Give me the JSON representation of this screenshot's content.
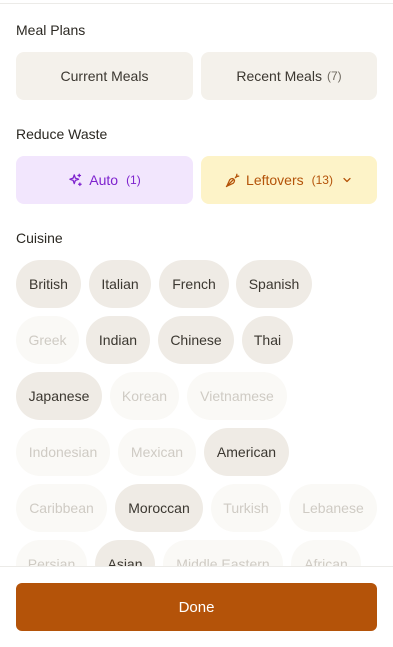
{
  "meal_plans": {
    "title": "Meal Plans",
    "current_label": "Current Meals",
    "recent_label": "Recent Meals",
    "recent_count": "(7)"
  },
  "reduce_waste": {
    "title": "Reduce Waste",
    "auto_label": "Auto",
    "auto_count": "(1)",
    "auto_icon": "sparkles-icon",
    "leftovers_label": "Leftovers",
    "leftovers_count": "(13)",
    "leftovers_icon": "carrot-icon",
    "accent_auto": "#7e22ce",
    "accent_leftovers": "#b45309"
  },
  "cuisine": {
    "title": "Cuisine",
    "chips": [
      {
        "label": "British",
        "active": true
      },
      {
        "label": "Italian",
        "active": true
      },
      {
        "label": "French",
        "active": true
      },
      {
        "label": "Spanish",
        "active": true
      },
      {
        "label": "Greek",
        "active": false
      },
      {
        "label": "Indian",
        "active": true
      },
      {
        "label": "Chinese",
        "active": true
      },
      {
        "label": "Thai",
        "active": true
      },
      {
        "label": "Japanese",
        "active": true
      },
      {
        "label": "Korean",
        "active": false
      },
      {
        "label": "Vietnamese",
        "active": false
      },
      {
        "label": "Indonesian",
        "active": false
      },
      {
        "label": "Mexican",
        "active": false
      },
      {
        "label": "American",
        "active": true
      },
      {
        "label": "Caribbean",
        "active": false
      },
      {
        "label": "Moroccan",
        "active": true
      },
      {
        "label": "Turkish",
        "active": false
      },
      {
        "label": "Lebanese",
        "active": false
      },
      {
        "label": "Persian",
        "active": false
      },
      {
        "label": "Asian",
        "active": true
      },
      {
        "label": "Middle Eastern",
        "active": false
      },
      {
        "label": "African",
        "active": false
      }
    ]
  },
  "footer": {
    "done_label": "Done",
    "accent": "#b45309"
  }
}
